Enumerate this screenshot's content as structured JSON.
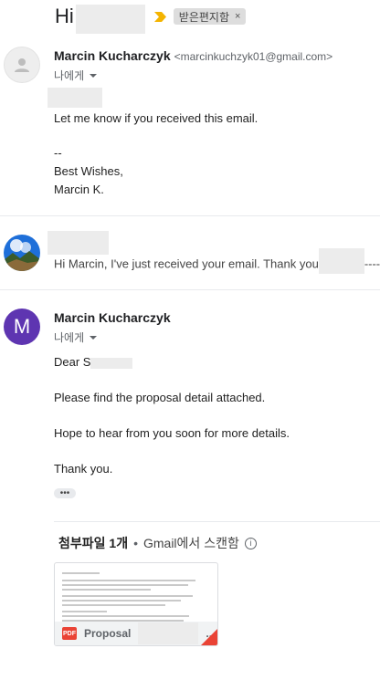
{
  "subject": {
    "prefix": "Hi",
    "label": "받은편지함",
    "label_close": "×"
  },
  "message1": {
    "sender_name": "Marcin Kucharczyk",
    "sender_email": "<marcinkuchzyk01@gmail.com>",
    "to_me": "나에게",
    "body": [
      "Let me know if you received this email.",
      "--",
      "Best Wishes,",
      "Marcin K."
    ]
  },
  "message2": {
    "snippet": "Hi Marcin, I've just received your email. Thank you",
    "snippet_tail": "----"
  },
  "message3": {
    "avatar_letter": "M",
    "avatar_color": "#5e35b1",
    "sender_name": "Marcin Kucharczyk",
    "to_me": "나에게",
    "greeting": "Dear S",
    "body": [
      "Please find the proposal detail attached.",
      "Hope to hear from you soon for more details.",
      "Thank you."
    ],
    "ellipsis": "•••"
  },
  "attachments": {
    "count_label": "첨부파일 1개",
    "separator": "•",
    "scan_label": "Gmail에서 스캔함",
    "info_icon": "ⓘ",
    "file": {
      "type_badge": "PDF",
      "name": "Proposal",
      "name_suffix": "..."
    }
  },
  "colors": {
    "accent_important": "#f4b400",
    "pdf_red": "#ea4335"
  }
}
